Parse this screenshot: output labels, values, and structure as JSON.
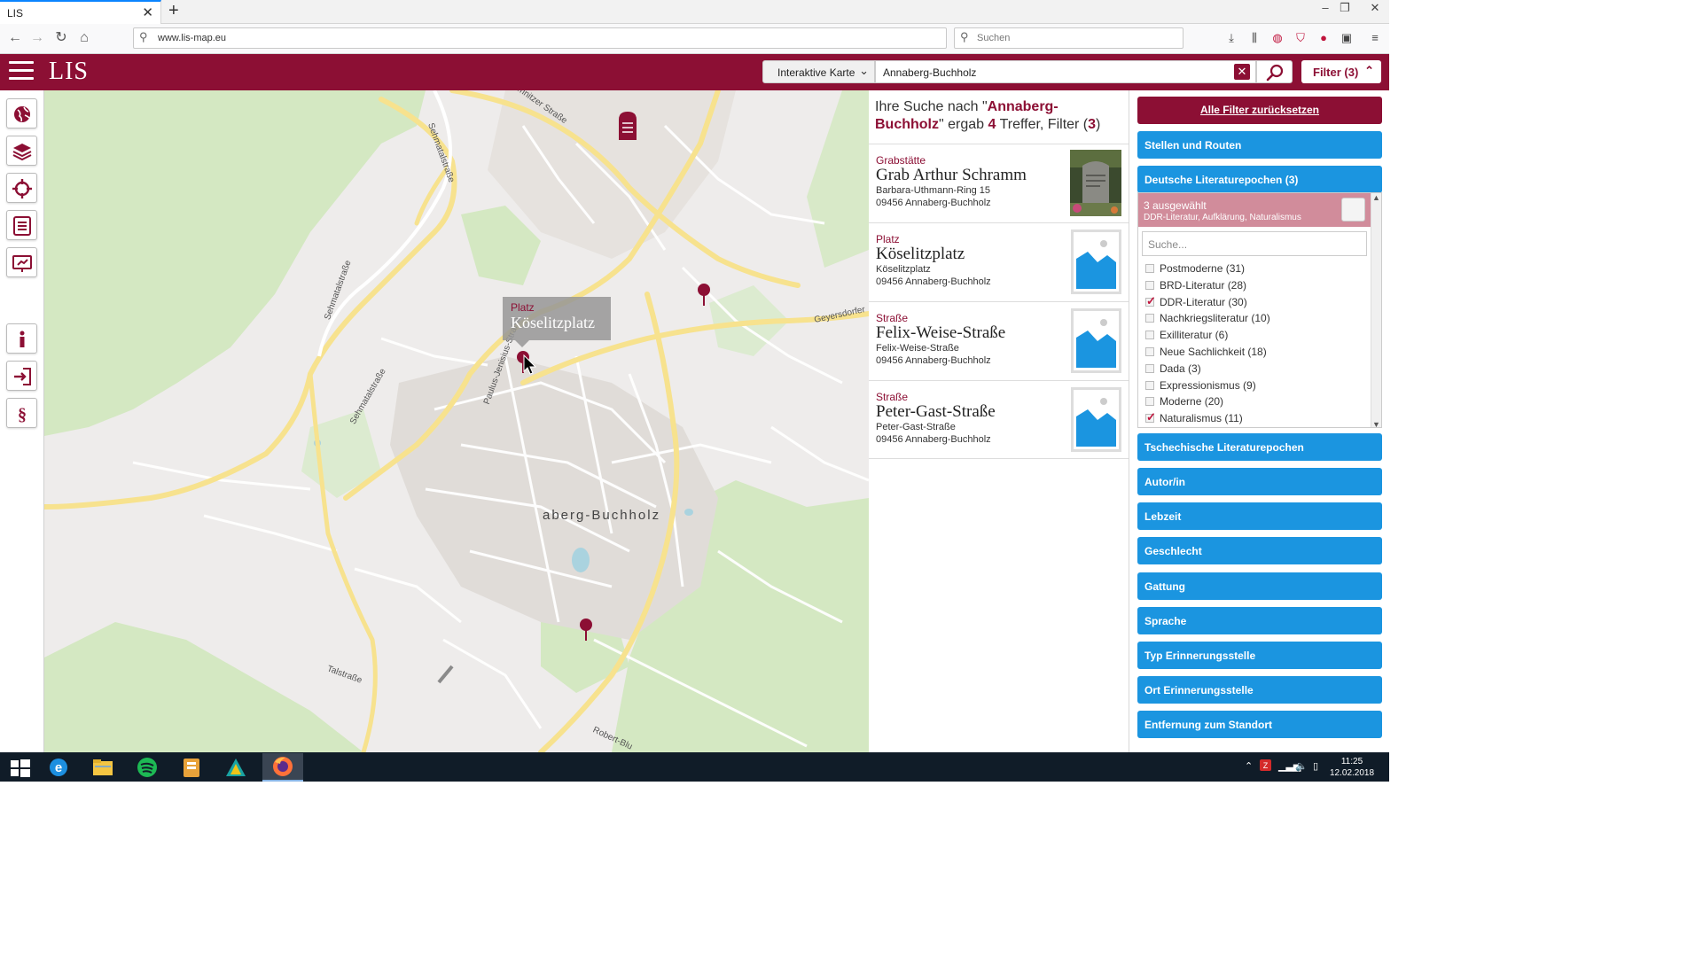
{
  "browser": {
    "tab_title": "LIS",
    "tab_close": "✕",
    "new_tab": "+",
    "url": "www.lis-map.eu",
    "search_placeholder": "Suchen",
    "win_min": "–",
    "win_max": "❐",
    "win_close": "✕"
  },
  "app": {
    "brand": "LIS",
    "mode": "Interaktive Karte",
    "query": "Annaberg-Buchholz",
    "filter_label": "Filter (3)",
    "accent_color": "#8c0f34",
    "button_color": "#1b95e0"
  },
  "map": {
    "city_label": "aberg-Buchholz",
    "street_labels": [
      "Chemnitzer Straße",
      "Sehmatalstraße",
      "Sehmatalstraße",
      "Sehmatalstraße",
      "Paulus-Jenisius-Straße",
      "Geyersdorfer",
      "Talstraße",
      "Robert-Blu"
    ],
    "popup": {
      "category": "Platz",
      "title": "Köselitzplatz"
    }
  },
  "results": {
    "heading_prefix": "Ihre Suche nach \"",
    "heading_query": "Annaberg-Buchholz",
    "heading_mid": "\" ergab ",
    "heading_count": "4",
    "heading_mid2": " Treffer, Filter (",
    "heading_filters": "3",
    "heading_suffix": ")",
    "items": [
      {
        "category": "Grabstätte",
        "name": "Grab Arthur Schramm",
        "street": "Barbara-Uthmann-Ring 15",
        "city": "09456 Annaberg-Buchholz"
      },
      {
        "category": "Platz",
        "name": "Köselitzplatz",
        "street": "Köselitzplatz",
        "city": "09456 Annaberg-Buchholz"
      },
      {
        "category": "Straße",
        "name": "Felix-Weise-Straße",
        "street": "Felix-Weise-Straße",
        "city": "09456 Annaberg-Buchholz"
      },
      {
        "category": "Straße",
        "name": "Peter-Gast-Straße",
        "street": "Peter-Gast-Straße",
        "city": "09456 Annaberg-Buchholz"
      }
    ]
  },
  "filters": {
    "reset": "Alle Filter zurücksetzen",
    "groups_top": [
      "Stellen und Routen",
      "Deutsche Literaturepochen (3)"
    ],
    "selected_summary": "3 ausgewählt",
    "selected_detail": "DDR-Literatur, Aufklärung, Naturalismus",
    "search_placeholder": "Suche...",
    "options": [
      {
        "label": "Postmoderne (31)",
        "checked": false
      },
      {
        "label": "BRD-Literatur (28)",
        "checked": false
      },
      {
        "label": "DDR-Literatur (30)",
        "checked": true
      },
      {
        "label": "Nachkriegsliteratur (10)",
        "checked": false
      },
      {
        "label": "Exilliteratur (6)",
        "checked": false
      },
      {
        "label": "Neue Sachlichkeit (18)",
        "checked": false
      },
      {
        "label": "Dada (3)",
        "checked": false
      },
      {
        "label": "Expressionismus (9)",
        "checked": false
      },
      {
        "label": "Moderne (20)",
        "checked": false
      },
      {
        "label": "Naturalismus (11)",
        "checked": true
      }
    ],
    "groups_bottom": [
      "Tschechische Literaturepochen",
      "Autor/in",
      "Lebzeit",
      "Geschlecht",
      "Gattung",
      "Sprache",
      "Typ Erinnerungsstelle",
      "Ort Erinnerungsstelle",
      "Entfernung zum Standort"
    ]
  },
  "taskbar": {
    "time": "11:25",
    "date": "12.02.2018",
    "tray_up": "⌃"
  }
}
